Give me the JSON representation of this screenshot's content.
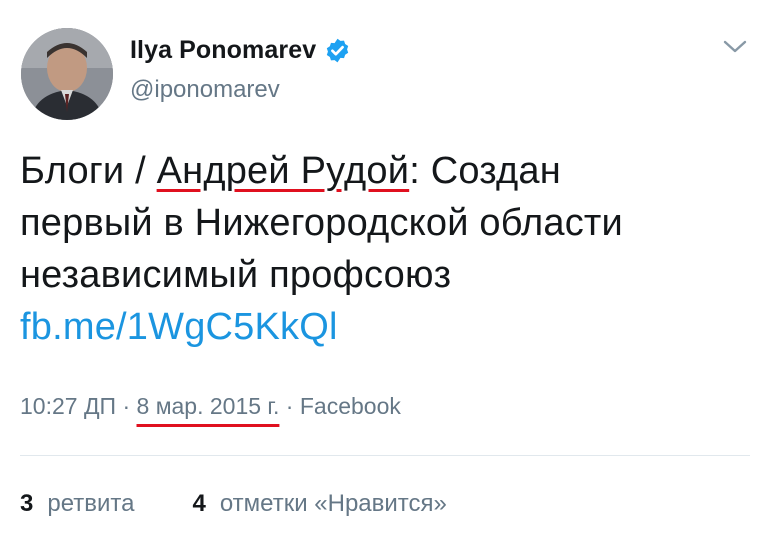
{
  "author": {
    "name": "Ilya Ponomarev",
    "handle": "@iponomarev",
    "verified": true
  },
  "tweet": {
    "text_prefix": "Блоги / ",
    "text_highlight": "Андрей Рудой",
    "text_line1_suffix": ": Создан",
    "text_line2": "первый в Нижегородской области",
    "text_line3": "независимый профсоюз",
    "link": "fb.me/1WgC5KkQl"
  },
  "meta": {
    "time": "10:27 ДП",
    "sep1": " · ",
    "date": "8 мар. 2015 г.",
    "sep2": " · ",
    "source": "Facebook"
  },
  "stats": {
    "retweets_count": "3",
    "retweets_label": "ретвита",
    "likes_count": "4",
    "likes_label": "отметки «Нравится»"
  },
  "colors": {
    "link": "#1b95e0",
    "secondary_text": "#657786",
    "primary_text": "#14171a",
    "verified_badge": "#1da1f2",
    "annotation_underline": "#e0101f"
  },
  "icons": {
    "verified": "verified-badge-icon",
    "menu": "chevron-down-icon"
  }
}
